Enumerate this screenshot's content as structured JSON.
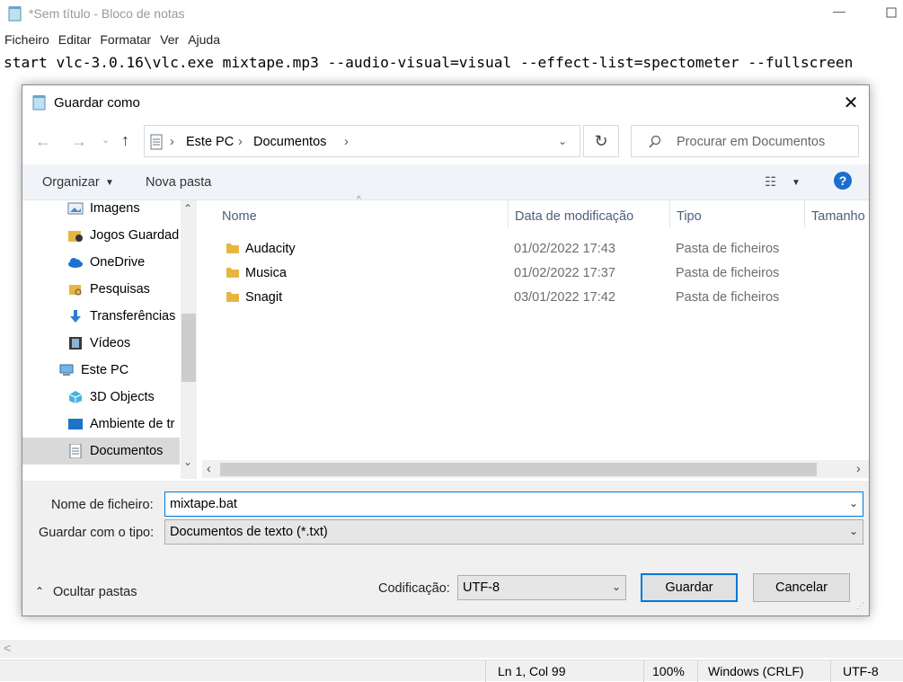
{
  "notepad": {
    "title": "*Sem título - Bloco de notas",
    "menu": [
      "Ficheiro",
      "Editar",
      "Formatar",
      "Ver",
      "Ajuda"
    ],
    "content": "start vlc-3.0.16\\vlc.exe mixtape.mp3 --audio-visual=visual --effect-list=spectometer --fullscreen",
    "status": {
      "position": "Ln 1, Col 99",
      "zoom": "100%",
      "line_ending": "Windows (CRLF)",
      "encoding": "UTF-8"
    }
  },
  "dialog": {
    "title": "Guardar como",
    "breadcrumb": [
      "Este PC",
      "Documentos"
    ],
    "search_placeholder": "Procurar em Documentos",
    "toolbar": {
      "organize": "Organizar",
      "new_folder": "Nova pasta"
    },
    "nav_items": [
      {
        "label": "Imagens",
        "icon": "pictures-icon"
      },
      {
        "label": "Jogos Guardad",
        "icon": "saved-games-icon"
      },
      {
        "label": "OneDrive",
        "icon": "onedrive-cloud-icon"
      },
      {
        "label": "Pesquisas",
        "icon": "searches-folder-icon"
      },
      {
        "label": "Transferências",
        "icon": "downloads-arrow-icon"
      },
      {
        "label": "Vídeos",
        "icon": "videos-icon"
      },
      {
        "label": "Este PC",
        "icon": "computer-icon"
      },
      {
        "label": "3D Objects",
        "icon": "3d-objects-icon"
      },
      {
        "label": "Ambiente de tr",
        "icon": "desktop-icon"
      },
      {
        "label": "Documentos",
        "icon": "documents-icon",
        "selected": true
      }
    ],
    "columns": [
      "Nome",
      "Data de modificação",
      "Tipo",
      "Tamanho"
    ],
    "files": [
      {
        "name": "Audacity",
        "date": "01/02/2022 17:43",
        "type": "Pasta de ficheiros"
      },
      {
        "name": "Musica",
        "date": "01/02/2022 17:37",
        "type": "Pasta de ficheiros"
      },
      {
        "name": "Snagit",
        "date": "03/01/2022 17:42",
        "type": "Pasta de ficheiros"
      }
    ],
    "filename_label": "Nome de ficheiro:",
    "filename_value": "mixtape.bat",
    "filetype_label": "Guardar com o tipo:",
    "filetype_value": "Documentos de texto (*.txt)",
    "hide_folders": "Ocultar pastas",
    "encoding_label": "Codificação:",
    "encoding_value": "UTF-8",
    "save": "Guardar",
    "cancel": "Cancelar"
  },
  "colors": {
    "accent": "#0078d7",
    "folder": "#e8b640",
    "help": "#1a6fce"
  }
}
